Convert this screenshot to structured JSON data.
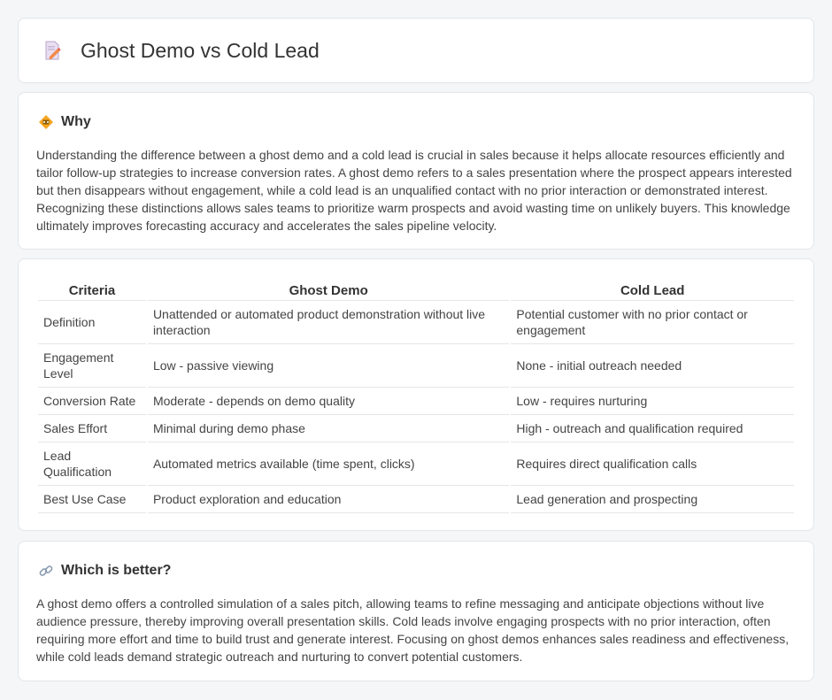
{
  "header": {
    "title": "Ghost Demo vs Cold Lead",
    "icon": "document-edit-icon"
  },
  "why": {
    "heading": "Why",
    "icon": "warning-sign-icon",
    "text": "Understanding the difference between a ghost demo and a cold lead is crucial in sales because it helps allocate resources efficiently and tailor follow-up strategies to increase conversion rates. A ghost demo refers to a sales presentation where the prospect appears interested but then disappears without engagement, while a cold lead is an unqualified contact with no prior interaction or demonstrated interest. Recognizing these distinctions allows sales teams to prioritize warm prospects and avoid wasting time on unlikely buyers. This knowledge ultimately improves forecasting accuracy and accelerates the sales pipeline velocity."
  },
  "table": {
    "headers": [
      "Criteria",
      "Ghost Demo",
      "Cold Lead"
    ],
    "rows": [
      [
        "Definition",
        "Unattended or automated product demonstration without live interaction",
        "Potential customer with no prior contact or engagement"
      ],
      [
        "Engagement Level",
        "Low - passive viewing",
        "None - initial outreach needed"
      ],
      [
        "Conversion Rate",
        "Moderate - depends on demo quality",
        "Low - requires nurturing"
      ],
      [
        "Sales Effort",
        "Minimal during demo phase",
        "High - outreach and qualification required"
      ],
      [
        "Lead Qualification",
        "Automated metrics available (time spent, clicks)",
        "Requires direct qualification calls"
      ],
      [
        "Best Use Case",
        "Product exploration and education",
        "Lead generation and prospecting"
      ]
    ]
  },
  "better": {
    "heading": "Which is better?",
    "icon": "link-icon",
    "text": "A ghost demo offers a controlled simulation of a sales pitch, allowing teams to refine messaging and anticipate objections without live audience pressure, thereby improving overall presentation skills. Cold leads involve engaging prospects with no prior interaction, often requiring more effort and time to build trust and generate interest. Focusing on ghost demos enhances sales readiness and effectiveness, while cold leads demand strategic outreach and nurturing to convert potential customers."
  }
}
